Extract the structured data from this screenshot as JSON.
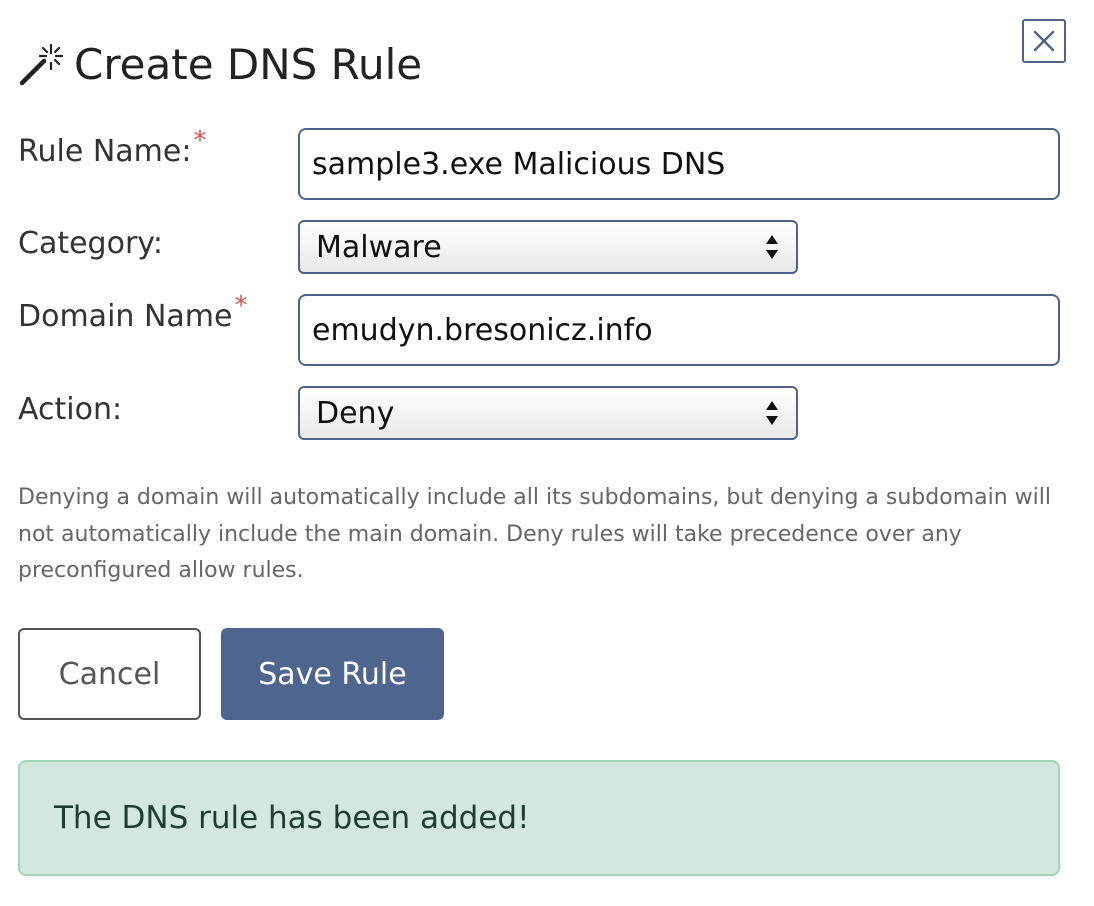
{
  "dialog": {
    "title": "Create DNS Rule",
    "close_icon": "close-icon",
    "title_icon": "magic-wand-icon"
  },
  "form": {
    "rule_name": {
      "label": "Rule Name:",
      "required_marker": "*",
      "value": "sample3.exe Malicious DNS"
    },
    "category": {
      "label": "Category:",
      "selected": "Malware"
    },
    "domain_name": {
      "label": "Domain Name",
      "required_marker": "*",
      "value": "emudyn.bresonicz.info"
    },
    "action": {
      "label": "Action:",
      "selected": "Deny"
    },
    "help_text": "Denying a domain will automatically include all its subdomains, but denying a subdomain will not automatically include the main domain. Deny rules will take precedence over any preconfigured allow rules."
  },
  "buttons": {
    "cancel_label": "Cancel",
    "save_label": "Save Rule"
  },
  "alert": {
    "message": "The DNS rule has been added!"
  },
  "colors": {
    "primary": "#4e6590",
    "required": "#d9534f",
    "success_bg": "#d2e8dd",
    "success_border": "#a3d5bb"
  }
}
